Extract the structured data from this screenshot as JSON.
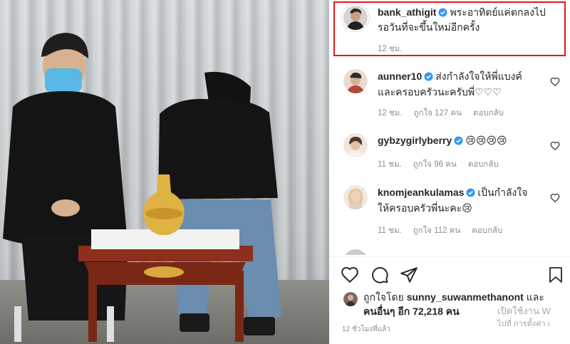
{
  "post": {
    "author": "bank_athigit",
    "caption_line1": "พระอาทิตย์แค่ตกลงไป",
    "caption_line2": "รอวันที่จะขึ้นใหม่อีกครั้ง",
    "time": "12 ชม."
  },
  "comments": [
    {
      "user": "aunner10",
      "text_line1": "ส่งกำลังใจให้พี่แบงค์",
      "text_line2": "และครอบครัวนะครับพี่♡♡♡",
      "time": "12 ชม.",
      "likes": "ถูกใจ 127 คน",
      "reply": "ตอบกลับ"
    },
    {
      "user": "gybzygirlyberry",
      "text_line1": "😢😢😢😢",
      "time": "11 ชม.",
      "likes": "ถูกใจ 96 คน",
      "reply": "ตอบกลับ"
    },
    {
      "user": "knomjeankulamas",
      "text_line1": "เป็นกำลังใจ",
      "text_line2": "ให้ครอบครัวพี่นะคะ😢",
      "time": "11 ชม.",
      "likes": "ถูกใจ 112 คน",
      "reply": "ตอบกลับ"
    }
  ],
  "likes_summary": {
    "prefix": "ถูกใจโดย",
    "user": "sunny_suwanmethanont",
    "and": "และ",
    "others": "คนอื่นๆ อีก 72,218 คน"
  },
  "timestamp": "12 ชั่วโมงที่แล้ว",
  "watermark": {
    "line1": "เปิดใช้งาน W",
    "line2": "ไปที่ การตั้งค่า เ"
  },
  "colors": {
    "verified": "#3897f0",
    "highlight_border": "#e0181b",
    "muted": "#8e8e8e"
  },
  "icons": [
    "heart-icon",
    "comment-icon",
    "share-icon",
    "bookmark-icon",
    "verified-badge-icon"
  ]
}
